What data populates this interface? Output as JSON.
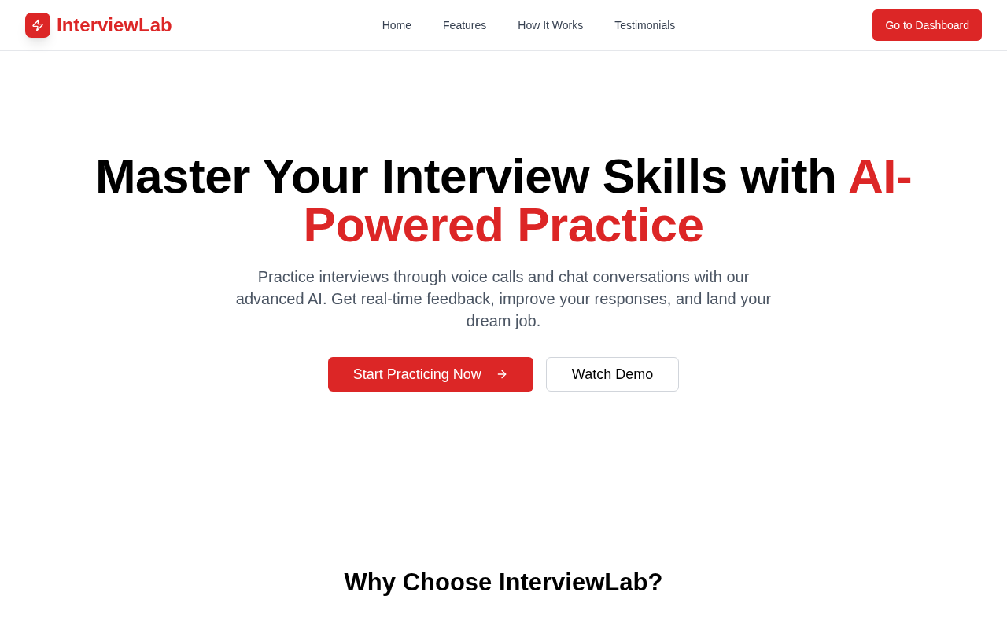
{
  "header": {
    "brand": "InterviewLab",
    "nav": [
      {
        "label": "Home"
      },
      {
        "label": "Features"
      },
      {
        "label": "How It Works"
      },
      {
        "label": "Testimonials"
      }
    ],
    "cta": "Go to Dashboard"
  },
  "hero": {
    "title": "Master Your Interview Skills with ",
    "title_highlight": "AI-Powered Practice",
    "subtitle": "Practice interviews through voice calls and chat conversations with our advanced AI. Get real-time feedback, improve your responses, and land your dream job.",
    "buttons": [
      {
        "label": "Start Practicing Now",
        "kind": "primary"
      },
      {
        "label": "Watch Demo",
        "kind": "secondary"
      }
    ]
  },
  "features": {
    "title": "Why Choose InterviewLab?"
  }
}
